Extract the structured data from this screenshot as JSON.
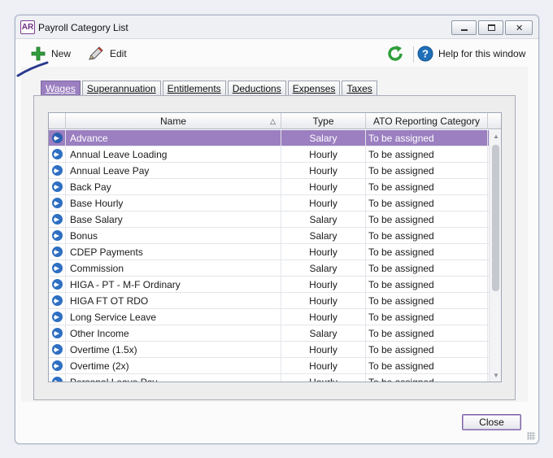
{
  "window": {
    "app_icon_text": "AR",
    "title": "Payroll Category List"
  },
  "toolbar": {
    "new_label": "New",
    "edit_label": "Edit",
    "help_label": "Help for this window"
  },
  "tabs": [
    {
      "label": "Wages",
      "active": true
    },
    {
      "label": "Superannuation",
      "active": false
    },
    {
      "label": "Entitlements",
      "active": false
    },
    {
      "label": "Deductions",
      "active": false
    },
    {
      "label": "Expenses",
      "active": false
    },
    {
      "label": "Taxes",
      "active": false
    }
  ],
  "grid": {
    "columns": [
      "Name",
      "Type",
      "ATO Reporting Category"
    ],
    "sort_indicator": "△",
    "rows": [
      {
        "name": "Advance",
        "type": "Salary",
        "ato": "To be assigned",
        "selected": true
      },
      {
        "name": "Annual Leave Loading",
        "type": "Hourly",
        "ato": "To be assigned"
      },
      {
        "name": "Annual Leave Pay",
        "type": "Hourly",
        "ato": "To be assigned"
      },
      {
        "name": "Back Pay",
        "type": "Hourly",
        "ato": "To be assigned"
      },
      {
        "name": "Base Hourly",
        "type": "Hourly",
        "ato": "To be assigned"
      },
      {
        "name": "Base Salary",
        "type": "Salary",
        "ato": "To be assigned"
      },
      {
        "name": "Bonus",
        "type": "Salary",
        "ato": "To be assigned"
      },
      {
        "name": "CDEP Payments",
        "type": "Hourly",
        "ato": "To be assigned"
      },
      {
        "name": "Commission",
        "type": "Salary",
        "ato": "To be assigned"
      },
      {
        "name": "HIGA - PT - M-F Ordinary",
        "type": "Hourly",
        "ato": "To be assigned"
      },
      {
        "name": "HIGA FT OT RDO",
        "type": "Hourly",
        "ato": "To be assigned"
      },
      {
        "name": "Long Service Leave",
        "type": "Hourly",
        "ato": "To be assigned"
      },
      {
        "name": "Other Income",
        "type": "Salary",
        "ato": "To be assigned"
      },
      {
        "name": "Overtime (1.5x)",
        "type": "Hourly",
        "ato": "To be assigned"
      },
      {
        "name": "Overtime (2x)",
        "type": "Hourly",
        "ato": "To be assigned"
      },
      {
        "name": "Personal Leave Pay",
        "type": "Hourly",
        "ato": "To be assigned"
      }
    ]
  },
  "footer": {
    "close_label": "Close"
  },
  "colors": {
    "accent": "#9b7fc0",
    "row_icon": "#2e6fc2",
    "new_icon": "#2f9e3a",
    "refresh_icon": "#2f9e3a",
    "help_icon": "#1f6fb8",
    "callout": "#2a3a8f"
  },
  "icons": {
    "new": "plus-icon",
    "edit": "pencil-icon",
    "refresh": "refresh-icon",
    "help": "help-icon",
    "row": "go-arrow-icon"
  }
}
